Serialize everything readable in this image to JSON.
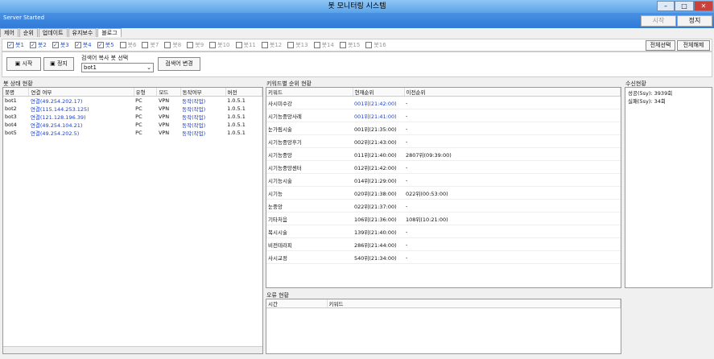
{
  "window": {
    "title": "봇 모니터링 시스템",
    "min": "–",
    "max": "□",
    "server_status": "Server Started",
    "start": "시작",
    "stop": "정지"
  },
  "tabs": [
    "제어",
    "순위",
    "업데이트",
    "유지보수",
    "블로그"
  ],
  "bots": [
    {
      "label": "봇1",
      "on": true
    },
    {
      "label": "봇2",
      "on": true
    },
    {
      "label": "봇3",
      "on": true
    },
    {
      "label": "봇4",
      "on": true
    },
    {
      "label": "봇5",
      "on": true
    },
    {
      "label": "봇6",
      "on": false
    },
    {
      "label": "봇7",
      "on": false
    },
    {
      "label": "봇8",
      "on": false
    },
    {
      "label": "봇9",
      "on": false
    },
    {
      "label": "봇10",
      "on": false
    },
    {
      "label": "봇11",
      "on": false
    },
    {
      "label": "봇12",
      "on": false
    },
    {
      "label": "봇13",
      "on": false
    },
    {
      "label": "봇14",
      "on": false
    },
    {
      "label": "봇15",
      "on": false
    },
    {
      "label": "봇16",
      "on": false
    }
  ],
  "select_all": "전체선택",
  "deselect_all": "전체해제",
  "controls": {
    "start": "시작",
    "stop": "정지",
    "select_label": "검색어 복사 봇 선택",
    "select_value": "bot1",
    "change_btn": "검색어 변경"
  },
  "bot_status": {
    "title": "봇 상태 현황",
    "headers": [
      "봇명",
      "연결 여부",
      "유형",
      "모드",
      "동작여부",
      "버전"
    ],
    "rows": [
      [
        "bot1",
        "연결(49.254.202.17)",
        "PC",
        "VPN",
        "동작(작업)",
        "1.0.5.1"
      ],
      [
        "bot2",
        "연결(115.144.253.125)",
        "PC",
        "VPN",
        "동작(작업)",
        "1.0.5.1"
      ],
      [
        "bot3",
        "연결(121.128.196.39)",
        "PC",
        "VPN",
        "동작(작업)",
        "1.0.5.1"
      ],
      [
        "bot4",
        "연결(49.254.104.21)",
        "PC",
        "VPN",
        "동작(작업)",
        "1.0.5.1"
      ],
      [
        "bot5",
        "연결(49.254.202.5)",
        "PC",
        "VPN",
        "동작(작업)",
        "1.0.5.1"
      ]
    ]
  },
  "keyword_rank": {
    "title": "키워드별 순위 현황",
    "headers": [
      "키워드",
      "현재순위",
      "이전순위"
    ],
    "rows": [
      [
        "사시미수강",
        "001위(21:42:00)",
        "-"
      ],
      [
        "시기능중앙사례",
        "001위(21:41:00)",
        "-"
      ],
      [
        "눈가림시술",
        "001위(21:35:00)",
        "-"
      ],
      [
        "시기능중앙후기",
        "002위(21:43:00)",
        "-"
      ],
      [
        "시기능중앙",
        "011위(21:40:00)",
        "2807위(09:39:00)"
      ],
      [
        "시기능중앙센터",
        "012위(21:42:00)",
        "-"
      ],
      [
        "시기능시술",
        "014위(21:29:00)",
        "-"
      ],
      [
        "시기능",
        "020위(21:38:00)",
        "022위(00:53:00)"
      ],
      [
        "눈중앙",
        "022위(21:37:00)",
        "-"
      ],
      [
        "기타처음",
        "106위(21:36:00)",
        "108위(10:21:00)"
      ],
      [
        "복시시술",
        "139위(21:40:00)",
        "-"
      ],
      [
        "비전테라피",
        "286위(21:44:00)",
        "-"
      ],
      [
        "사시교정",
        "540위(21:34:00)",
        "-"
      ]
    ]
  },
  "errors": {
    "title": "오류 현황",
    "headers": [
      "시간",
      "키워드"
    ]
  },
  "success": {
    "title": "수신현황",
    "items": [
      "성공(5sy): 3939회",
      "실패(5sy): 34회"
    ]
  }
}
